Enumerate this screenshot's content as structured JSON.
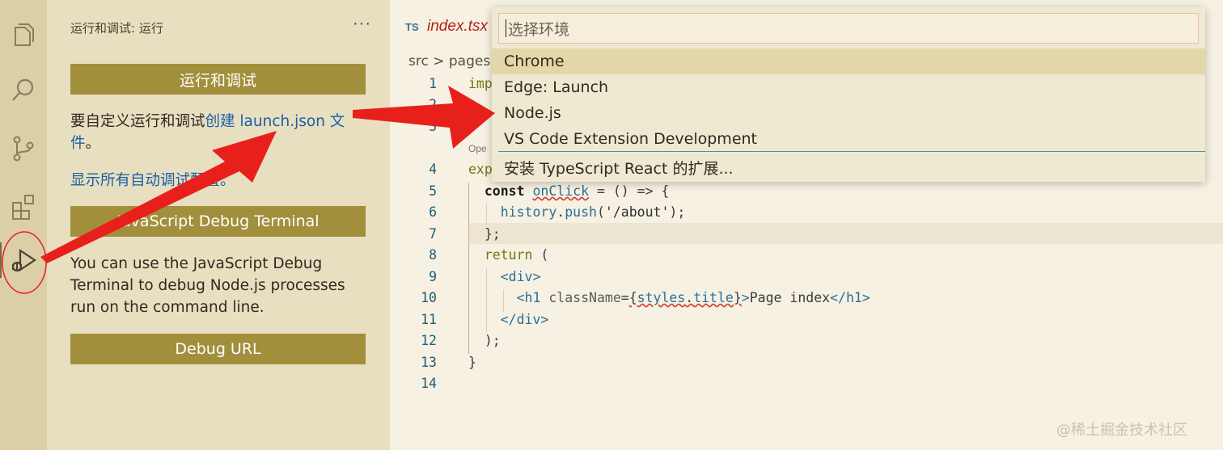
{
  "activity_bar": {
    "icons": [
      "explorer-icon",
      "search-icon",
      "source-control-icon",
      "extensions-icon",
      "run-debug-icon"
    ]
  },
  "sidebar": {
    "title": "运行和调试: 运行",
    "more": "···",
    "run_debug_button": "运行和调试",
    "customize_prefix": "要自定义运行和调试",
    "customize_link": "创建 launch.json 文件",
    "customize_suffix": "。",
    "show_all_link": "显示所有自动调试配置。",
    "js_terminal_button": "JavaScript Debug Terminal",
    "js_terminal_desc": "You can use the JavaScript Debug Terminal to debug Node.js processes run on the command line.",
    "debug_url_button": "Debug URL"
  },
  "editor": {
    "tab_lang": "TS",
    "tab_name": "index.tsx",
    "breadcrumb": "src > pages",
    "lens": "Ope",
    "line_numbers": [
      "1",
      "2",
      "3",
      "4",
      "5",
      "6",
      "7",
      "8",
      "9",
      "10",
      "11",
      "12",
      "13",
      "14"
    ]
  },
  "quick_pick": {
    "placeholder": "选择环境",
    "items": [
      "Chrome",
      "Edge: Launch",
      "Node.js",
      "VS Code Extension Development"
    ],
    "install_item": "安装 TypeScript React 的扩展..."
  },
  "watermark": "@稀土掘金技术社区",
  "colors": {
    "accent_button": "#a28f3c",
    "link": "#1a5fa8",
    "annotation": "#e8201c",
    "selected_item": "#e3d7a9"
  }
}
